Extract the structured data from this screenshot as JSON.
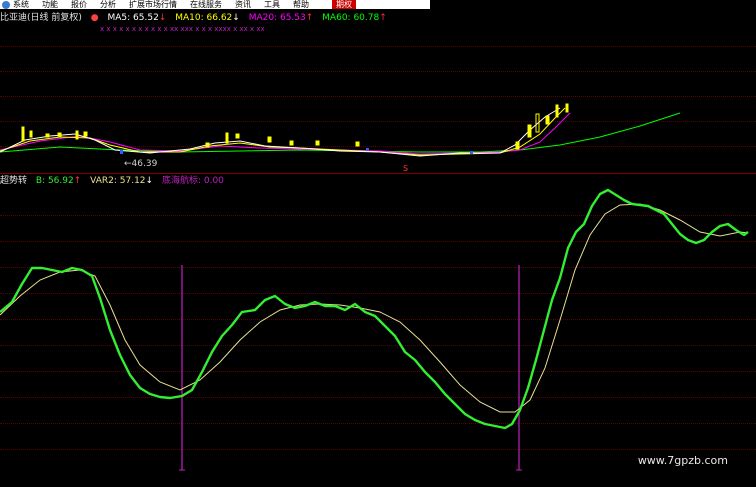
{
  "menu": {
    "items": [
      "系统",
      "功能",
      "报价",
      "分析",
      "扩展市场行情",
      "在线服务",
      "资讯",
      "工具",
      "帮助"
    ],
    "active": "期权"
  },
  "header": {
    "stock_title": "比亚迪(日线 前复权)",
    "ma5": "MA5: 65.52",
    "ma10": "MA10: 66.62",
    "ma20": "MA20: 65.53",
    "ma60": "MA60: 60.78",
    "low_marker": "←46.39",
    "s_marker": "S"
  },
  "indicator": {
    "title": "超势转",
    "b": "B: 56.92",
    "var2": "VAR2: 57.12",
    "signal": "底海航标: 0.00"
  },
  "colors": {
    "ma5": "#ffffff",
    "ma10": "#ffff00",
    "ma20": "#ff00ff",
    "ma60": "#00ff00",
    "b_line": "#33ee33",
    "var2_line": "#e8e090",
    "signal": "#c020c0",
    "arrow_up": "#ff3030",
    "arrow_down": "#ffffff"
  },
  "watermark": "www.7gpzb.com"
}
